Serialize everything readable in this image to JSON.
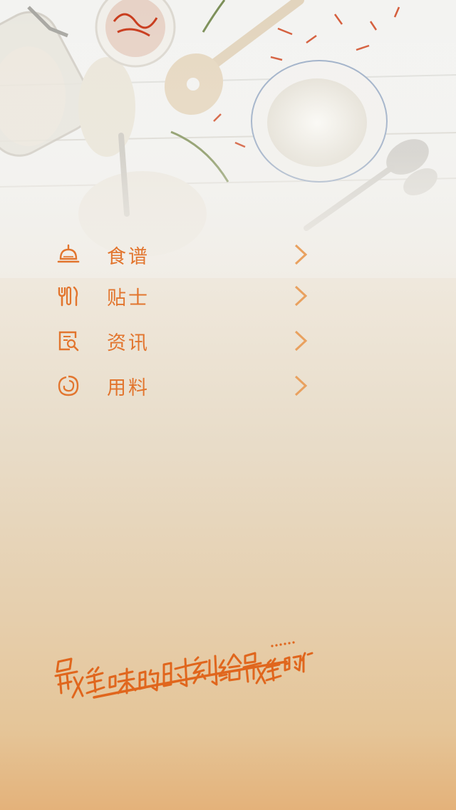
{
  "colors": {
    "accent": "#e2752e",
    "chevron": "#e9a15f"
  },
  "menu": {
    "items": [
      {
        "label": "食谱",
        "icon": "cloche-icon"
      },
      {
        "label": "贴士",
        "icon": "utensils-icon"
      },
      {
        "label": "资讯",
        "icon": "news-search-icon"
      },
      {
        "label": "用料",
        "icon": "ingredient-icon"
      }
    ]
  },
  "slogan": {
    "text": "最美味的时刻给最美的你……"
  }
}
